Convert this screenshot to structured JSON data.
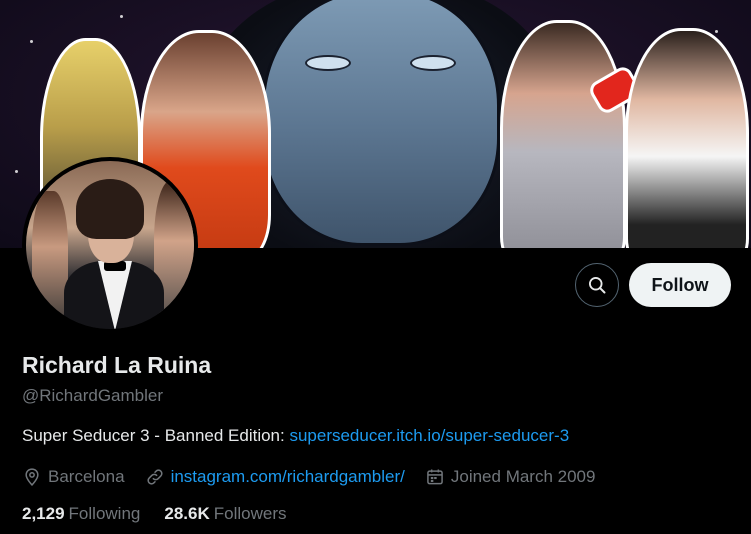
{
  "profile": {
    "display_name": "Richard La Ruina",
    "handle": "@RichardGambler",
    "bio_text": "Super Seducer 3 - Banned Edition: ",
    "bio_link": "superseducer.itch.io/super-seducer-3",
    "location": "Barcelona",
    "website": "instagram.com/richardgambler/",
    "joined": "Joined March 2009"
  },
  "actions": {
    "search_icon": "search-icon",
    "follow_label": "Follow"
  },
  "stats": {
    "following_count": "2,129",
    "following_label": "Following",
    "followers_count": "28.6K",
    "followers_label": "Followers"
  },
  "colors": {
    "background": "#000000",
    "link": "#1d9bf0",
    "muted": "#71767b",
    "text": "#e7e9ea",
    "follow_button_bg": "#eff3f4"
  }
}
